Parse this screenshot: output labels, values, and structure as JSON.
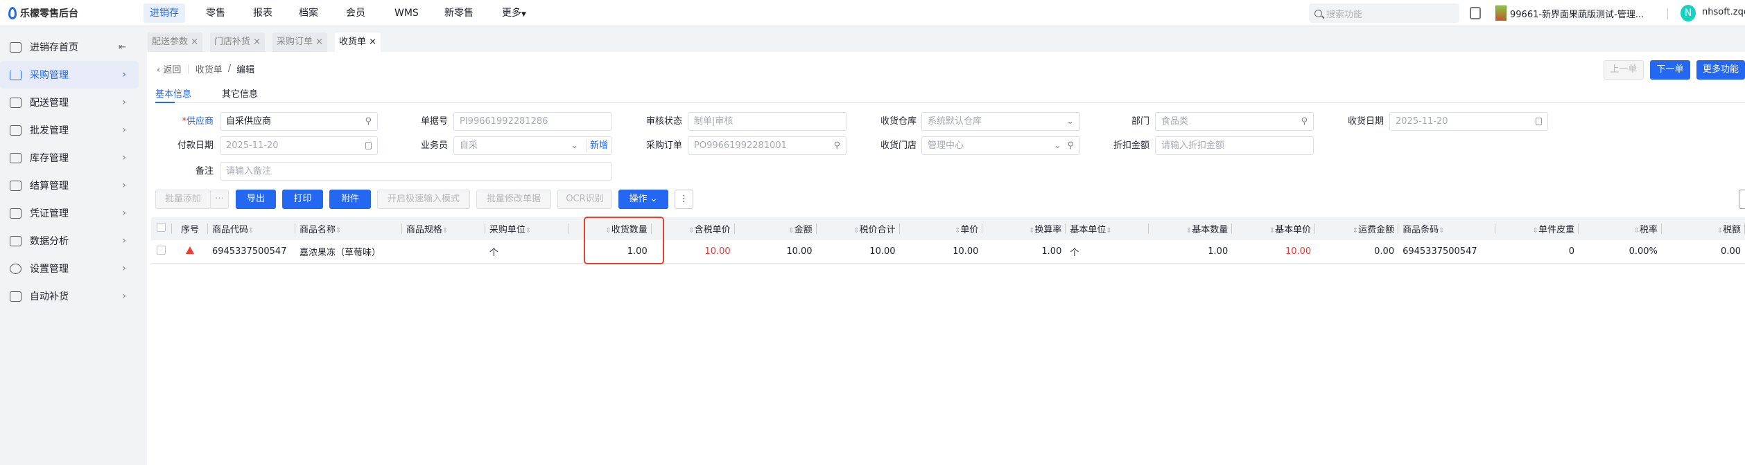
{
  "header": {
    "app_name": "乐檬零售后台",
    "nav": [
      "进销存",
      "零售",
      "报表",
      "档案",
      "会员",
      "WMS",
      "新零售",
      "更多"
    ],
    "nav_active": 0,
    "search_placeholder": "搜索功能",
    "store": "99661-新界面果蔬版测试-管理...",
    "avatar_letter": "N",
    "user": "nhsoft.zqc"
  },
  "sidebar": {
    "items": [
      {
        "label": "进销存首页",
        "icon": "home-icon"
      },
      {
        "label": "采购管理",
        "icon": "cart-icon"
      },
      {
        "label": "配送管理",
        "icon": "map-icon"
      },
      {
        "label": "批发管理",
        "icon": "server-icon"
      },
      {
        "label": "库存管理",
        "icon": "inbox-icon"
      },
      {
        "label": "结算管理",
        "icon": "dollar-icon"
      },
      {
        "label": "凭证管理",
        "icon": "document-icon"
      },
      {
        "label": "数据分析",
        "icon": "chart-icon"
      },
      {
        "label": "设置管理",
        "icon": "settings-icon"
      },
      {
        "label": "自动补货",
        "icon": "replenish-icon"
      }
    ]
  },
  "page_tabs": [
    "配送参数",
    "门店补货",
    "采购订单",
    "收货单"
  ],
  "breadcrumb": {
    "back": "返回",
    "parent": "收货单",
    "sep": "/",
    "current": "编辑"
  },
  "top_actions": {
    "prev": "上一单",
    "next": "下一单",
    "more": "更多功能"
  },
  "sub_tabs": [
    "基本信息",
    "其它信息"
  ],
  "form": {
    "supplier": {
      "label": "供应商",
      "value": "自采供应商"
    },
    "doc_no": {
      "label": "单据号",
      "placeholder": "PI99661992281286"
    },
    "audit_status": {
      "label": "审核状态",
      "placeholder": "制单|审核"
    },
    "warehouse": {
      "label": "收货仓库",
      "placeholder": "系统默认仓库"
    },
    "department": {
      "label": "部门",
      "placeholder": "食品类"
    },
    "receive_date": {
      "label": "收货日期",
      "placeholder": "2025-11-20"
    },
    "pay_date": {
      "label": "付款日期",
      "placeholder": "2025-11-20"
    },
    "salesman": {
      "label": "业务员",
      "placeholder": "自采",
      "add": "新增"
    },
    "purchase_order": {
      "label": "采购订单",
      "placeholder": "PO99661992281001"
    },
    "store": {
      "label": "收货门店",
      "placeholder": "管理中心"
    },
    "discount": {
      "label": "折扣金额",
      "placeholder": "请输入折扣金额"
    },
    "remark": {
      "label": "备注",
      "placeholder": "请输入备注"
    }
  },
  "toolbar": {
    "batch_add": "批量添加",
    "more": "···",
    "export": "导出",
    "print": "打印",
    "attach": "附件",
    "fast_mode": "开启极速输入模式",
    "batch_edit": "批量修改单据",
    "ocr": "OCR识别",
    "operate": "操作"
  },
  "table": {
    "headers": [
      "序号",
      "商品代码",
      "商品名称",
      "商品规格",
      "采购单位",
      "收货数量",
      "含税单价",
      "金额",
      "税价合计",
      "单价",
      "换算率",
      "基本单位",
      "基本数量",
      "基本单价",
      "运费金额",
      "商品条码",
      "单件皮重",
      "税率",
      "税额"
    ],
    "rows": [
      {
        "code": "6945337500547",
        "name": "嘉浓果冻（草莓味）",
        "spec": "",
        "unit": "个",
        "qty": "1.00",
        "tax_price": "10.00",
        "amount": "10.00",
        "tax_total": "10.00",
        "price": "10.00",
        "rate": "1.00",
        "base_unit": "个",
        "base_qty": "1.00",
        "base_price": "10.00",
        "freight": "0.00",
        "barcode": "6945337500547",
        "tare": "0",
        "tax_rate": "0.00%",
        "tax": "0.00"
      }
    ]
  }
}
